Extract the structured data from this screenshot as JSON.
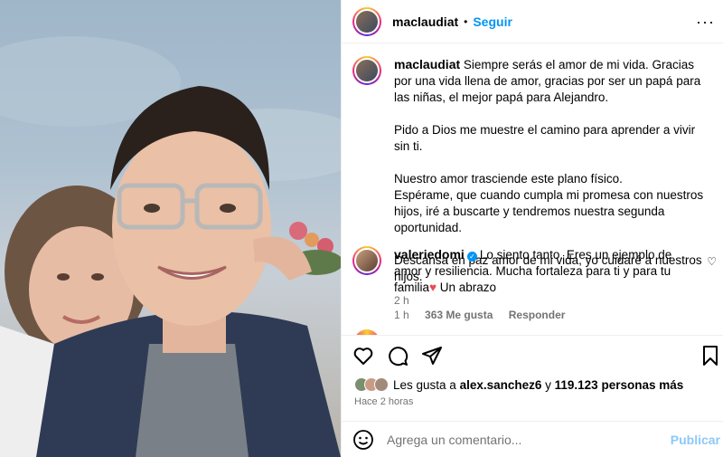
{
  "post": {
    "username": "maclaudiat",
    "follow_label": "Seguir",
    "separator": "•",
    "more_label": "···"
  },
  "caption": {
    "username": "maclaudiat",
    "paragraphs": [
      "Siempre serás el amor de mi vida. Gracias por una vida llena de amor, gracias por ser un papá para las niñas, el mejor papá para Alejandro.",
      "Pido a Dios me muestre el camino para aprender a vivir sin ti.",
      "Nuestro amor trasciende este plano físico.",
      "Espérame, que cuando cumpla mi promesa con nuestros hijos, iré a buscarte y tendremos nuestra segunda oportunidad.",
      "Descansa en paz amor de mi vida, yo cuidaré a nuestros hijos."
    ],
    "time": "2 h"
  },
  "comment": {
    "username": "valeriedomi",
    "text": "Lo siento tanto. Eres un ejemplo de amor y resiliencia. Mucha fortaleza para ti y para tu familia",
    "heart": "♥",
    "text_end": " Un abrazo",
    "time": "1 h",
    "likes": "363 Me gusta",
    "reply_label": "Responder"
  },
  "likes": {
    "prefix": "Les gusta a ",
    "user": "alex.sanchez6",
    "middle": " y ",
    "count": "119.123 personas más"
  },
  "time_ago": "Hace 2 horas",
  "add_comment": {
    "placeholder": "Agrega un comentario...",
    "publish_label": "Publicar"
  },
  "icons": {
    "like": "heart-outline-icon",
    "comment": "comment-bubble-icon",
    "share": "paper-plane-icon",
    "save": "bookmark-icon",
    "emoji": "smiley-icon"
  },
  "colors": {
    "link": "#0095f6",
    "publish_disabled": "#8cc8f8",
    "muted": "#737373"
  }
}
